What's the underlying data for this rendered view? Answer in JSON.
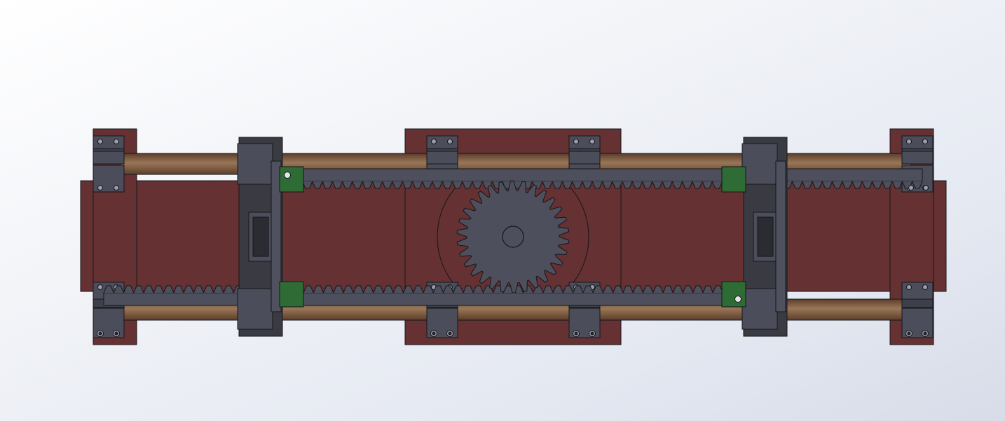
{
  "viewport": {
    "background_top": "#dfe4ee",
    "background_bottom": "#ffffff"
  },
  "model": {
    "part_colors": {
      "frame": "#653133",
      "frame_edge": "#2a1213",
      "rail": "#6e4e38",
      "rail_highlight": "#9a7658",
      "rack": "#4d505c",
      "gear": "#4d505c",
      "bracket": "#4b4e5a",
      "carriage_dark": "#3a3b42",
      "connector": "#2f6b34",
      "line": "#16161a"
    },
    "gear_teeth": 30,
    "rack_teeth_per_row": 64
  }
}
